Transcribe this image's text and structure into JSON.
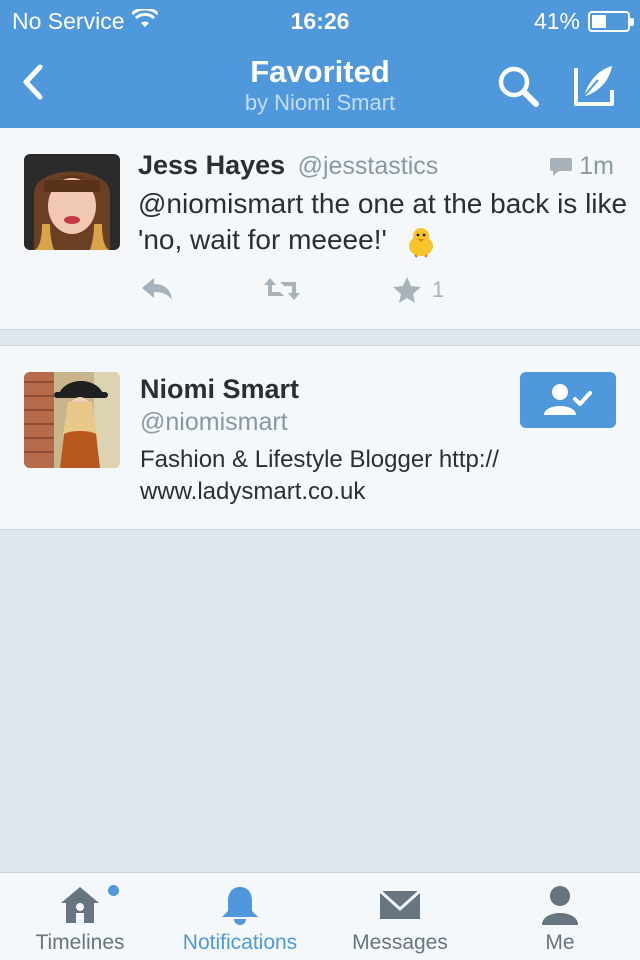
{
  "status_bar": {
    "carrier": "No Service",
    "time": "16:26",
    "battery": "41%",
    "battery_level": 0.41
  },
  "nav": {
    "title": "Favorited",
    "subtitle": "by Niomi Smart",
    "back_icon": "chevron-left-icon",
    "search_icon": "search-icon",
    "compose_icon": "compose-icon"
  },
  "tweet": {
    "name": "Jess Hayes",
    "handle": "@jesstastics",
    "time": "1m",
    "text": "@niomismart the one at the back is like 'no, wait for meeee!'",
    "fav_count": "1",
    "emoji": "chick-icon"
  },
  "profile": {
    "name": "Niomi Smart",
    "handle": "@niomismart",
    "bio": "Fashion & Lifestyle Blogger http:// www.ladysmart.co.uk",
    "follow_icon": "following-check-icon"
  },
  "tabs": [
    {
      "label": "Timelines",
      "icon": "home-icon",
      "active": false,
      "badge": true
    },
    {
      "label": "Notifications",
      "icon": "bell-icon",
      "active": true,
      "badge": false
    },
    {
      "label": "Messages",
      "icon": "envelope-icon",
      "active": false,
      "badge": false
    },
    {
      "label": "Me",
      "icon": "person-icon",
      "active": false,
      "badge": false
    }
  ],
  "colors": {
    "accent": "#4f98dc",
    "text": "#292f33",
    "muted": "#8899a6",
    "background": "#e1e8ed",
    "card": "#f5f8fa"
  }
}
